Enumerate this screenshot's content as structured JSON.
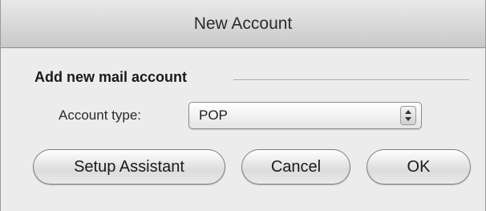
{
  "window": {
    "title": "New Account"
  },
  "group": {
    "label": "Add new mail account"
  },
  "account_type": {
    "label": "Account type:",
    "selected": "POP"
  },
  "buttons": {
    "setup": "Setup Assistant",
    "cancel": "Cancel",
    "ok": "OK"
  },
  "icons": {
    "select_arrows": "updown-chevron-icon"
  }
}
